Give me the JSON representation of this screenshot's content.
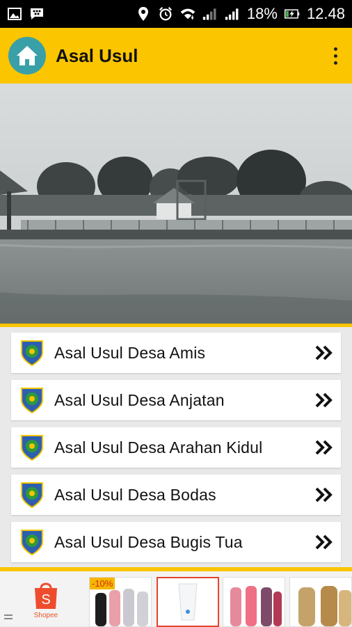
{
  "status_bar": {
    "battery": "18%",
    "time": "12.48",
    "icons": [
      "gallery-icon",
      "bbm-icon",
      "location-icon",
      "alarm-icon",
      "wifi-icon",
      "signal-icon",
      "signal-icon",
      "battery-charging-icon"
    ]
  },
  "app_bar": {
    "title": "Asal Usul",
    "icon": "home-icon",
    "menu_icon": "more-vert-icon"
  },
  "list": {
    "items": [
      {
        "label": "Asal Usul Desa Amis"
      },
      {
        "label": "Asal Usul Desa Anjatan"
      },
      {
        "label": "Asal Usul Desa Arahan Kidul"
      },
      {
        "label": "Asal Usul Desa Bodas"
      },
      {
        "label": "Asal Usul Desa Bugis Tua"
      }
    ]
  },
  "ad_bar": {
    "shopee_label": "Shopee",
    "discount": "-10%"
  },
  "colors": {
    "accent": "#fbc500",
    "home_circle": "#3aa0a8",
    "emblem_green": "#2e9a3a",
    "emblem_blue": "#2d5fb0",
    "shopee_orange": "#ee4d2d"
  }
}
